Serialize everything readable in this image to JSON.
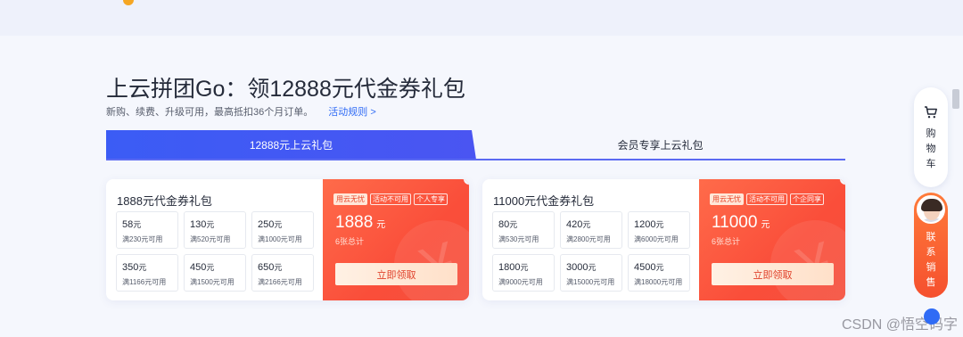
{
  "header": {
    "title": "上云拼团Go：领12888元代金券礼包",
    "subtitle": "新购、续费、升级可用，最高抵扣36个月订单。",
    "rules_link": "活动规则 >"
  },
  "tabs": [
    {
      "label": "12888元上云礼包",
      "active": true
    },
    {
      "label": "会员专享上云礼包",
      "active": false
    }
  ],
  "cards": [
    {
      "title": "1888元代金券礼包",
      "vouchers": [
        {
          "amount": "58",
          "unit": "元",
          "cond": "满230元可用"
        },
        {
          "amount": "130",
          "unit": "元",
          "cond": "满520元可用"
        },
        {
          "amount": "250",
          "unit": "元",
          "cond": "满1000元可用"
        },
        {
          "amount": "350",
          "unit": "元",
          "cond": "满1166元可用"
        },
        {
          "amount": "450",
          "unit": "元",
          "cond": "满1500元可用"
        },
        {
          "amount": "650",
          "unit": "元",
          "cond": "满2166元可用"
        }
      ],
      "tags": [
        "用云无忧",
        "活动不可用",
        "个人专享"
      ],
      "total_amount": "1888",
      "total_unit": "元",
      "count": "6张总计",
      "claim_label": "立即领取"
    },
    {
      "title": "11000元代金券礼包",
      "vouchers": [
        {
          "amount": "80",
          "unit": "元",
          "cond": "满530元可用"
        },
        {
          "amount": "420",
          "unit": "元",
          "cond": "满2800元可用"
        },
        {
          "amount": "1200",
          "unit": "元",
          "cond": "满6000元可用"
        },
        {
          "amount": "1800",
          "unit": "元",
          "cond": "满9000元可用"
        },
        {
          "amount": "3000",
          "unit": "元",
          "cond": "满15000元可用"
        },
        {
          "amount": "4500",
          "unit": "元",
          "cond": "满18000元可用"
        }
      ],
      "tags": [
        "用云无忧",
        "活动不可用",
        "个企同享"
      ],
      "total_amount": "11000",
      "total_unit": "元",
      "count": "6张总计",
      "claim_label": "立即领取"
    }
  ],
  "side": {
    "cart_label": "购物车",
    "sales_label": "联系销售"
  },
  "watermark": "CSDN @悟空码字",
  "colors": {
    "brand_blue": "#3b5cf5",
    "link_blue": "#2f6bf5",
    "promo_red": "#fa4e3a",
    "sales_orange": "#ff7b3a"
  }
}
